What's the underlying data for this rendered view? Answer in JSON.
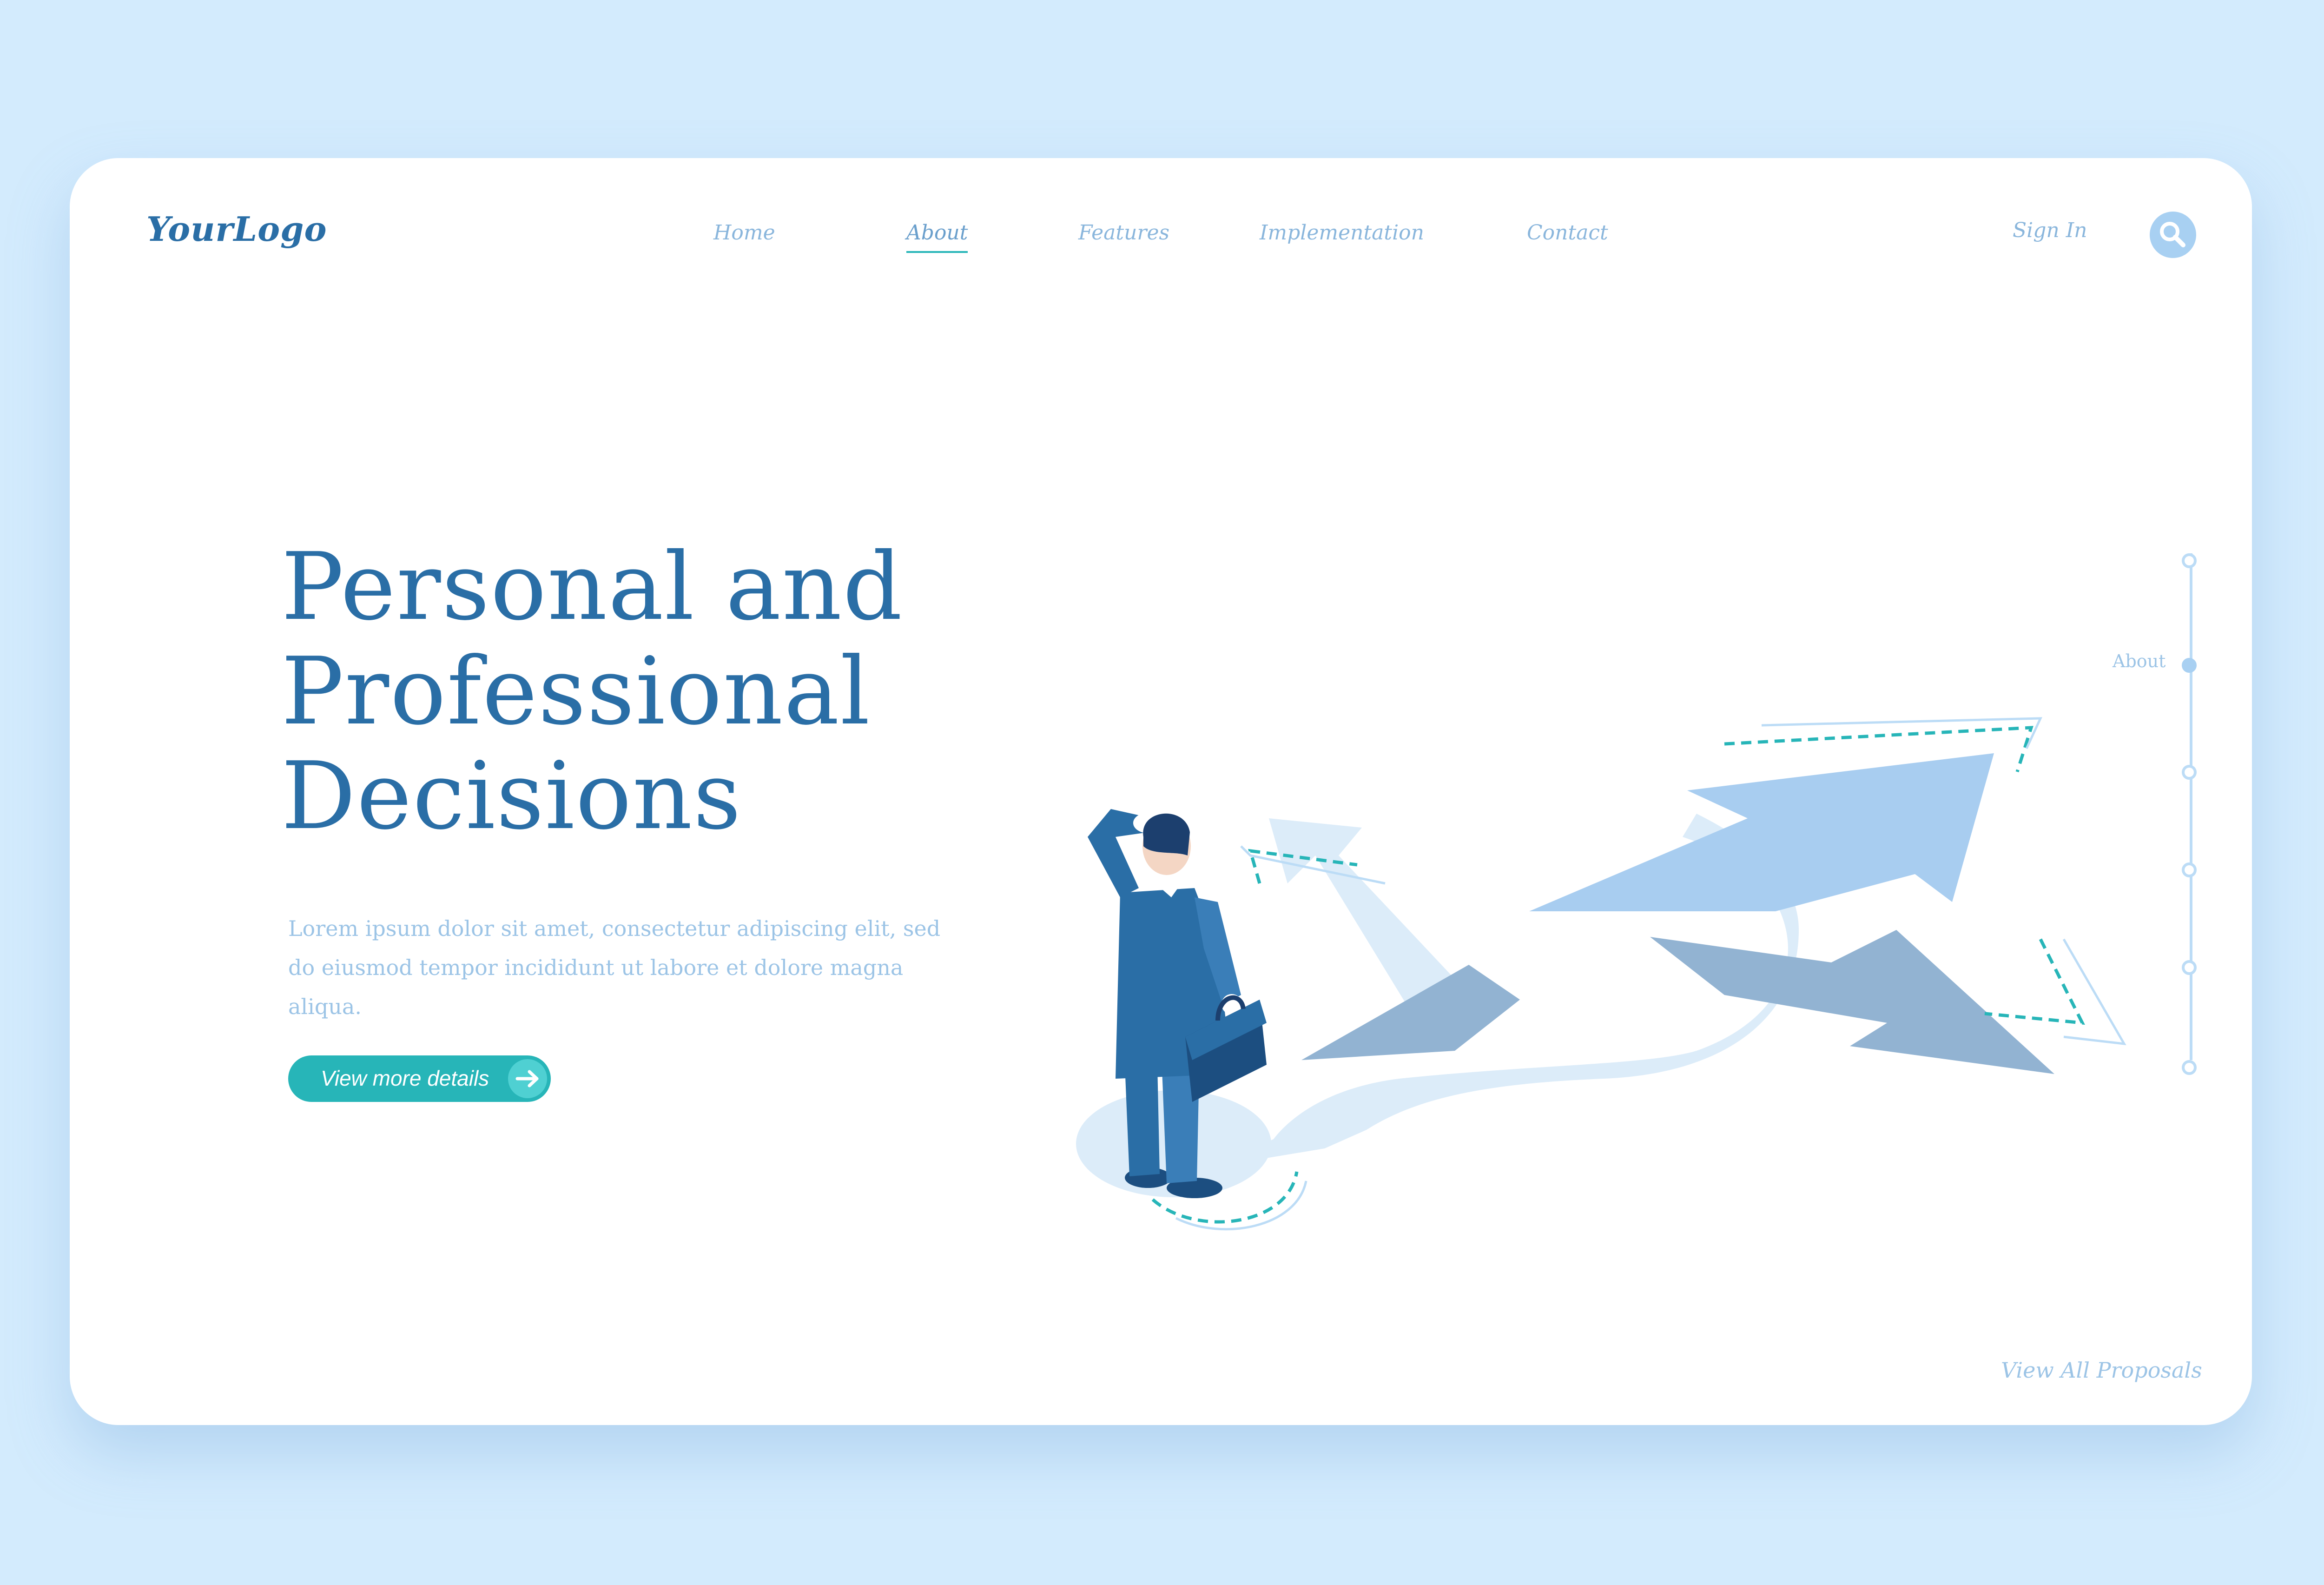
{
  "brand": {
    "logo": "YourLogo"
  },
  "nav": {
    "items": [
      {
        "label": "Home"
      },
      {
        "label": "About"
      },
      {
        "label": "Features"
      },
      {
        "label": "Implementation"
      },
      {
        "label": "Contact"
      }
    ],
    "active": "About"
  },
  "header": {
    "sign_in": "Sign In",
    "search_icon": "search-icon"
  },
  "hero": {
    "title_lines": [
      "Personal and",
      "Professional",
      "Decisions"
    ],
    "lead": "Lorem ipsum dolor sit amet, consectetur adipiscing elit, sed do eiusmod tempor incididunt ut labore et dolore magna aliqua.",
    "cta_label": "View more details",
    "cta_icon": "arrow-right-icon"
  },
  "side_nav": {
    "active_label": "About",
    "dot_count": 6,
    "active_index": 1
  },
  "footer": {
    "view_all": "View All Proposals"
  },
  "colors": {
    "background": "#d3ebfd",
    "primary_text": "#2a6ea6",
    "muted_text": "#9cc4e6",
    "accent": "#27b5b8",
    "arrow_light": "#dcecf9",
    "arrow_mid": "#a8cdf0",
    "arrow_dark": "#92b3d2",
    "suit": "#2a6ea6"
  }
}
